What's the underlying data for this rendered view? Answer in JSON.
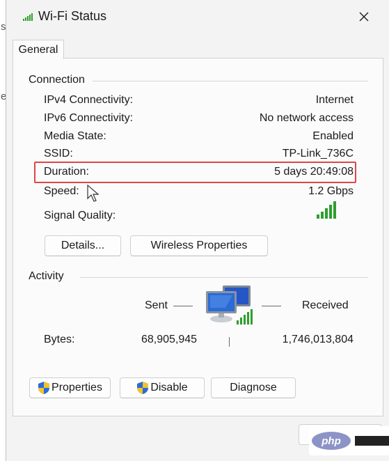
{
  "window": {
    "title": "Wi-Fi Status"
  },
  "tabs": [
    {
      "label": "General"
    }
  ],
  "connection": {
    "label": "Connection",
    "rows": [
      {
        "label": "IPv4 Connectivity:",
        "value": "Internet"
      },
      {
        "label": "IPv6 Connectivity:",
        "value": "No network access"
      },
      {
        "label": "Media State:",
        "value": "Enabled"
      },
      {
        "label": "SSID:",
        "value": "TP-Link_736C"
      },
      {
        "label": "Duration:",
        "value": "5 days 20:49:08"
      },
      {
        "label": "Speed:",
        "value": "1.2 Gbps"
      }
    ],
    "signal_label": "Signal Quality:",
    "signal_bars": 5,
    "details_button": "Details...",
    "wireless_button": "Wireless Properties"
  },
  "activity": {
    "label": "Activity",
    "sent_label": "Sent",
    "received_label": "Received",
    "bytes_label": "Bytes:",
    "bytes_sent": "68,905,945",
    "bytes_received": "1,746,013,804"
  },
  "actions": {
    "properties": "Properties",
    "disable": "Disable",
    "diagnose": "Diagnose"
  },
  "watermark": {
    "text": "php"
  },
  "colors": {
    "highlight": "#e04545",
    "signal": "#2e9e2e",
    "accent": "#2a6bd6"
  }
}
